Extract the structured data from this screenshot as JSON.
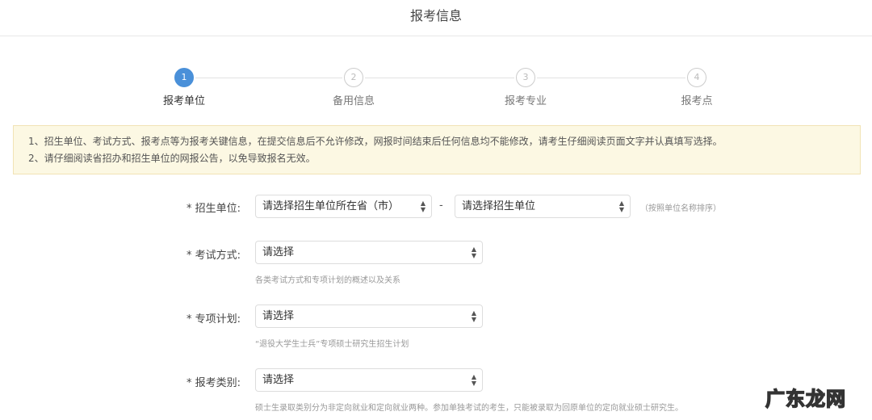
{
  "header": {
    "title": "报考信息"
  },
  "steps": [
    {
      "num": "1",
      "label": "报考单位"
    },
    {
      "num": "2",
      "label": "备用信息"
    },
    {
      "num": "3",
      "label": "报考专业"
    },
    {
      "num": "4",
      "label": "报考点"
    }
  ],
  "notice": [
    "1、招生单位、考试方式、报考点等为报考关键信息，在提交信息后不允许修改，网报时间结束后任何信息均不能修改，请考生仔细阅读页面文字并认真填写选择。",
    "2、请仔细阅读省招办和招生单位的网报公告，以免导致报名无效。"
  ],
  "form": {
    "unit": {
      "label": "* 招生单位:",
      "province_placeholder": "请选择招生单位所在省（市）",
      "dash": "-",
      "unit_placeholder": "请选择招生单位",
      "hint": "（按照单位名称排序）"
    },
    "exam_mode": {
      "label": "* 考试方式:",
      "value": "请选择",
      "help": "各类考试方式和专项计划的概述以及关系"
    },
    "special_plan": {
      "label": "* 专项计划:",
      "value": "请选择",
      "help": "“退役大学生士兵”专项硕士研究生招生计划"
    },
    "category": {
      "label": "* 报考类别:",
      "value": "请选择",
      "help": "硕士生录取类别分为非定向就业和定向就业两种。参加单独考试的考生，只能被录取为回原单位的定向就业硕士研究生。"
    }
  },
  "watermark": "广东龙网",
  "colors": {
    "accent": "#4a90d9",
    "notice_bg": "#fcf8e3"
  }
}
